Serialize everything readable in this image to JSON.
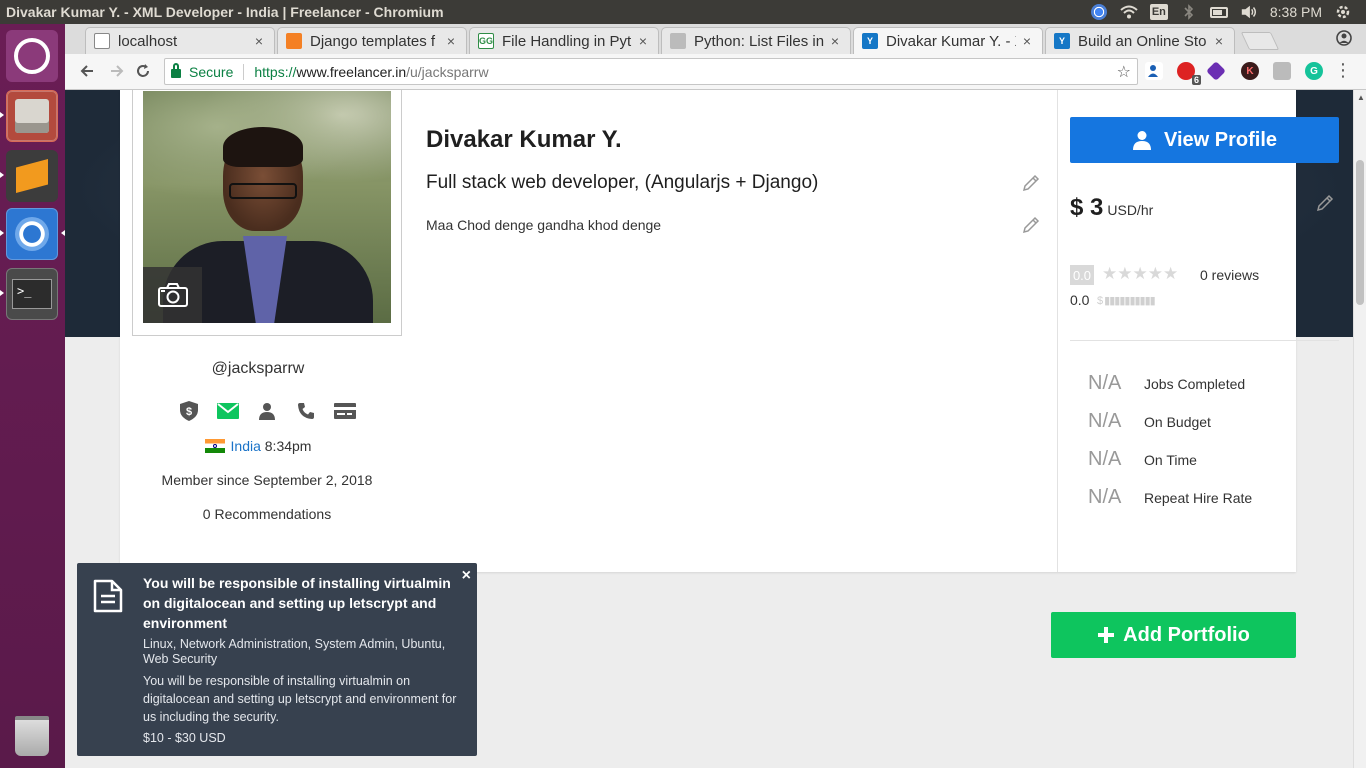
{
  "os": {
    "window_title": "Divakar Kumar Y. - XML Developer - India | Freelancer - Chromium",
    "keyboard_layout": "En",
    "clock": "8:38 PM"
  },
  "browser": {
    "tabs": [
      {
        "label": "localhost",
        "favicon": "page-icon",
        "active": false
      },
      {
        "label": "Django templates f",
        "favicon": "stackoverflow-icon",
        "active": false
      },
      {
        "label": "File Handling in Pyt",
        "favicon": "geeksforgeeks-icon",
        "active": false
      },
      {
        "label": "Python: List Files in",
        "favicon": "page-icon",
        "active": false
      },
      {
        "label": "Divakar Kumar Y. - X",
        "favicon": "freelancer-icon",
        "active": true
      },
      {
        "label": "Build an Online Sto",
        "favicon": "freelancer-icon",
        "active": false
      }
    ],
    "omnibox": {
      "secure_label": "Secure",
      "scheme": "https://",
      "host": "www.freelancer.in",
      "path": "/u/jacksparrw"
    },
    "extensions": [
      {
        "name": "extension-person-icon",
        "badge": ""
      },
      {
        "name": "extension-red-icon",
        "badge": "6"
      },
      {
        "name": "extension-purple-cube-icon",
        "badge": ""
      },
      {
        "name": "extension-k-icon",
        "badge": "K"
      },
      {
        "name": "extension-tile-icon",
        "badge": ""
      },
      {
        "name": "grammarly-icon",
        "badge": "G"
      }
    ]
  },
  "profile": {
    "name": "Divakar Kumar Y.",
    "headline": "Full stack web developer, (Angularjs + Django)",
    "summary": "Maa Chod denge gandha khod denge",
    "username": "@jacksparrw",
    "country": "India",
    "local_time": "8:34pm",
    "member_since": "Member since September 2, 2018",
    "recommendations": "0 Recommendations",
    "verification_icons": [
      "shield-dollar-icon",
      "email-verified-icon",
      "person-icon",
      "phone-icon",
      "payment-card-icon"
    ]
  },
  "sidebar": {
    "view_profile_label": "View Profile",
    "rate_amount": "$ 3",
    "rate_unit": "USD/hr",
    "rating_value": "0.0",
    "stars_filled": 0,
    "stars_total": 5,
    "reviews": "0 reviews",
    "earnings_score": "0.0",
    "stats": [
      {
        "value": "N/A",
        "label": "Jobs Completed"
      },
      {
        "value": "N/A",
        "label": "On Budget"
      },
      {
        "value": "N/A",
        "label": "On Time"
      },
      {
        "value": "N/A",
        "label": "Repeat Hire Rate"
      }
    ]
  },
  "add_portfolio_label": "Add Portfolio",
  "toast": {
    "title": "You will be responsible of installing virtualmin on digitalocean and setting up letscrypt and environment",
    "skills": "Linux, Network Administration, System Admin, Ubuntu, Web Security",
    "description": "You will be responsible of installing virtualmin on digitalocean and setting up letscrypt and environment for us including the security.",
    "price": "$10 - $30 USD",
    "close_glyph": "×"
  },
  "colors": {
    "primary_blue": "#1576e0",
    "success_green": "#0ec55e",
    "toast_bg": "#37414f",
    "launcher_bg": "#6a1d55"
  }
}
